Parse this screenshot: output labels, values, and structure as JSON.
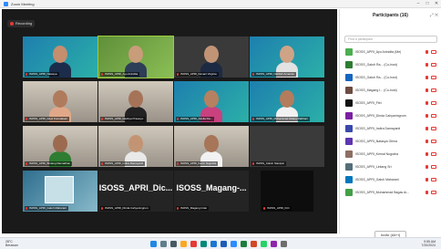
{
  "window": {
    "title": "Zoom Meeting"
  },
  "meeting": {
    "recording_label": "Recording",
    "tiles": [
      {
        "name": "ISOSS_APRI_Natasya",
        "style": "blue-teal",
        "face": "#c58e6f",
        "shirt": "#1b2d4b"
      },
      {
        "name": "ISOSS_APRI_Ayu Anindita",
        "style": "green",
        "face": "#c99c7a",
        "shirt": "#2e3d58",
        "active": true
      },
      {
        "name": "ISOSS_APRI_Devani Virginia",
        "style": "dark",
        "face": "#c19476",
        "shirt": "#1d2a44"
      },
      {
        "name": "ISOSS_APRI_Nabilah Amanda",
        "style": "blue-teal",
        "face": "#cfa386",
        "shirt": "#e2e2e2"
      },
      {
        "name": "ISOSS_APRI_Dewi Komalasari",
        "style": "room",
        "face": "#b07b5d",
        "shirt": "#e0a889"
      },
      {
        "name": "ISOSS_APRI_Raditya Prasetyo",
        "style": "room",
        "face": "#a57358",
        "shirt": "#222222"
      },
      {
        "name": "ISOSS_APRI_Adelia Ra...",
        "style": "blue-teal",
        "face": "#b58160",
        "shirt": "#c9417e"
      },
      {
        "name": "ISOSS_APRI_Muhammad Gilang Rabbani",
        "style": "blue-teal",
        "face": "#b37c5c",
        "shirt": "#f1f1f1"
      },
      {
        "name": "ISOSS_APRI_Bintang Ramadhan",
        "style": "room",
        "face": "#9c6b4f",
        "shirt": "#2e7d32"
      },
      {
        "name": "ISOSS_APRI_Indira Damayanti",
        "style": "room",
        "face": "#c39474",
        "shirt": "#e9e9e9"
      },
      {
        "name": "ISOSS_APRI_Kevin Nugraha",
        "style": "room",
        "face": "#a77558",
        "shirt": "#f2f2f2"
      },
      {
        "name": "ISOSS_Calvin Sianipar",
        "style": "dark",
        "face": "",
        "shirt": ""
      },
      {
        "name": "ISOSS_APRI_Galuh Maharani",
        "style": "poster",
        "face": "",
        "shirt": ""
      },
      {
        "name": "ISOSS_APRI_Dinda Cahyaningrum",
        "style": "blank",
        "big": "ISOSS_APRI_Dic..."
      },
      {
        "name": "ISOSS_Magang Intan",
        "style": "blank",
        "big": "ISOSS_Magang-..."
      },
      {
        "name": "ISOSS_APRI_Fitri",
        "style": "black",
        "face": "",
        "shirt": ""
      }
    ]
  },
  "participants": {
    "title": "Participants (16)",
    "search_placeholder": "Find a participant",
    "invite_label": "Invite (Alt+I)",
    "items": [
      {
        "name": "ISOSS_APRI_Ayu Anindita (Me)",
        "color": "#4caf50",
        "mic": "muted"
      },
      {
        "name": "ISOSS_Galuh Ra... (Co-host)",
        "color": "#2e7d32",
        "mic": "muted"
      },
      {
        "name": "ISOSS_Galuh Ra... (Co-host)",
        "color": "#1565c0",
        "mic": "muted"
      },
      {
        "name": "ISOSS_Magang I... (Co-host)",
        "color": "#6d4c41",
        "mic": "muted"
      },
      {
        "name": "ISOSS_APRI_Fitri",
        "color": "#111111",
        "mic": "muted"
      },
      {
        "name": "ISOSS_APRI_Dinda Cahyaningrum",
        "color": "#7b1fa2",
        "mic": "muted"
      },
      {
        "name": "ISOSS_APRI_Indira Damayanti",
        "color": "#3949ab",
        "mic": "muted"
      },
      {
        "name": "ISOSS_APRI_Natasya Ghina",
        "color": "#5e35b1",
        "mic": "muted"
      },
      {
        "name": "ISOSS_APRI_Kemal Nugraha",
        "color": "#8d6e63",
        "mic": "muted"
      },
      {
        "name": "ISOSS_APRI_Lintang Sri",
        "color": "#546e7a",
        "mic": "muted"
      },
      {
        "name": "ISOSS_APRI_Galuh Maharani",
        "color": "#0277bd",
        "mic": "muted"
      },
      {
        "name": "ISOSS_APRI_Muhammad Bagas Ar...",
        "color": "#43a047",
        "mic": "muted"
      }
    ]
  },
  "taskbar": {
    "weather_temp": "28°C",
    "weather_label": "Berawan",
    "time": "9:55 AM",
    "date": "7/20/2024",
    "apps": [
      {
        "name": "windows-start-icon",
        "color": "#1e88e5"
      },
      {
        "name": "search-icon",
        "color": "#607d8b"
      },
      {
        "name": "task-view-icon",
        "color": "#455a64"
      },
      {
        "name": "file-explorer-icon",
        "color": "#f9a825"
      },
      {
        "name": "chrome-icon",
        "color": "#e53935"
      },
      {
        "name": "edge-icon",
        "color": "#00897b"
      },
      {
        "name": "store-icon",
        "color": "#1976d2"
      },
      {
        "name": "word-icon",
        "color": "#1e5bb8"
      },
      {
        "name": "zoom-icon",
        "color": "#2d8cff"
      },
      {
        "name": "excel-icon",
        "color": "#1b7d3c"
      },
      {
        "name": "powerpoint-icon",
        "color": "#d24726"
      },
      {
        "name": "whatsapp-icon",
        "color": "#25d366"
      },
      {
        "name": "photos-icon",
        "color": "#8e24aa"
      },
      {
        "name": "settings-icon",
        "color": "#6d6d6d"
      }
    ]
  }
}
